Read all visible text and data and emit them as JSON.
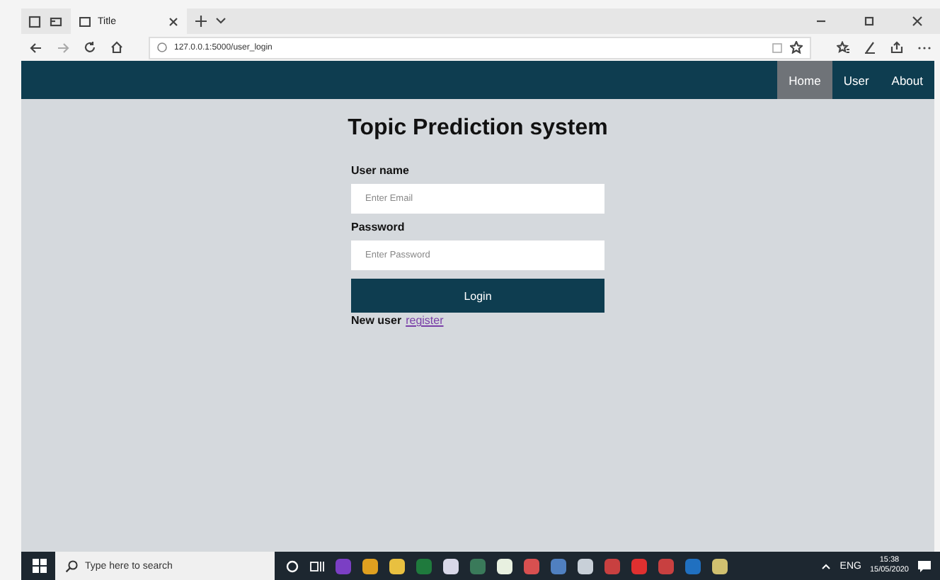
{
  "browser": {
    "tab": {
      "title": "Title"
    },
    "address": "127.0.0.1:5000/user_login"
  },
  "navbar": {
    "items": [
      {
        "label": "Home",
        "selected": true
      },
      {
        "label": "User",
        "selected": false
      },
      {
        "label": "About",
        "selected": false
      }
    ]
  },
  "page": {
    "heading": "Topic Prediction system",
    "fields": [
      {
        "label": "User name",
        "placeholder": "Enter Email"
      },
      {
        "label": "Password",
        "placeholder": "Enter Password"
      }
    ],
    "button": "Login",
    "new_user": "New user",
    "register_link": "register"
  },
  "taskbar": {
    "search": {
      "placeholder": "Type here to search"
    },
    "apps": [
      {
        "color": "#7b3fc4"
      },
      {
        "color": "#e0a020"
      },
      {
        "color": "#e8c040"
      },
      {
        "color": "#1f7a3d"
      },
      {
        "color": "#d8d8e8"
      },
      {
        "color": "#3a7a5a"
      },
      {
        "color": "#e8f0e0"
      },
      {
        "color": "#d85050"
      },
      {
        "color": "#5080c0"
      },
      {
        "color": "#c8d0d8"
      },
      {
        "color": "#c84040"
      },
      {
        "color": "#e03030"
      },
      {
        "color": "#c84040"
      },
      {
        "color": "#2070c0"
      },
      {
        "color": "#d0c070"
      }
    ],
    "language": "ENG",
    "time": "15:38",
    "date": "15/05/2020"
  }
}
